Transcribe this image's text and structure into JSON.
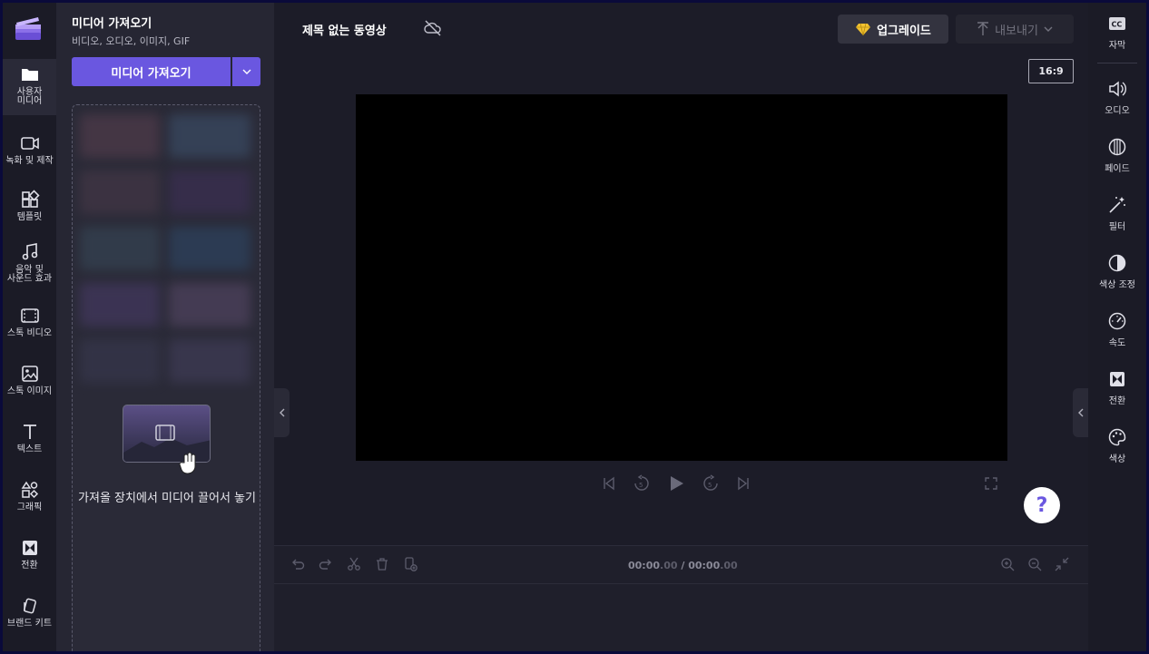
{
  "colors": {
    "accent": "#6a57e0",
    "background": "#1c1c28",
    "rail": "#1b1b26",
    "panel": "#262633"
  },
  "left_rail": {
    "items": [
      {
        "label": "사용자 미디어",
        "icon": "folder-icon"
      },
      {
        "label": "녹화 및 제작",
        "icon": "video-camera-icon"
      },
      {
        "label": "템플릿",
        "icon": "templates-icon"
      },
      {
        "label": "음악 및 사운드 효과",
        "icon": "music-note-icon"
      },
      {
        "label": "스톡 비디오",
        "icon": "film-icon"
      },
      {
        "label": "스톡 이미지",
        "icon": "image-icon"
      },
      {
        "label": "텍스트",
        "icon": "text-icon"
      },
      {
        "label": "그래픽",
        "icon": "shapes-icon"
      },
      {
        "label": "전환",
        "icon": "transition-icon"
      },
      {
        "label": "브랜드 키트",
        "icon": "brand-kit-icon"
      }
    ]
  },
  "media_panel": {
    "title": "미디어 가져오기",
    "subtitle": "비디오, 오디오, 이미지, GIF",
    "import_button": "미디어 가져오기",
    "drop_text": "가져올 장치에서 미디어 끌어서 놓기"
  },
  "header": {
    "project_title": "제목 없는 동영상",
    "upgrade_label": "업그레이드",
    "export_label": "내보내기",
    "aspect_ratio": "16:9"
  },
  "timeline": {
    "current_time": "00:00",
    "current_frac": ".00",
    "separator": " / ",
    "total_time": "00:00",
    "total_frac": ".00"
  },
  "help_label": "?",
  "right_rail": {
    "items": [
      {
        "label": "자막",
        "icon": "captions-icon"
      },
      {
        "label": "오디오",
        "icon": "speaker-icon"
      },
      {
        "label": "페이드",
        "icon": "fade-icon"
      },
      {
        "label": "필터",
        "icon": "magic-wand-icon"
      },
      {
        "label": "색상 조정",
        "icon": "contrast-icon"
      },
      {
        "label": "속도",
        "icon": "speedometer-icon"
      },
      {
        "label": "전환",
        "icon": "transition-icon"
      },
      {
        "label": "색상",
        "icon": "palette-icon"
      }
    ]
  }
}
